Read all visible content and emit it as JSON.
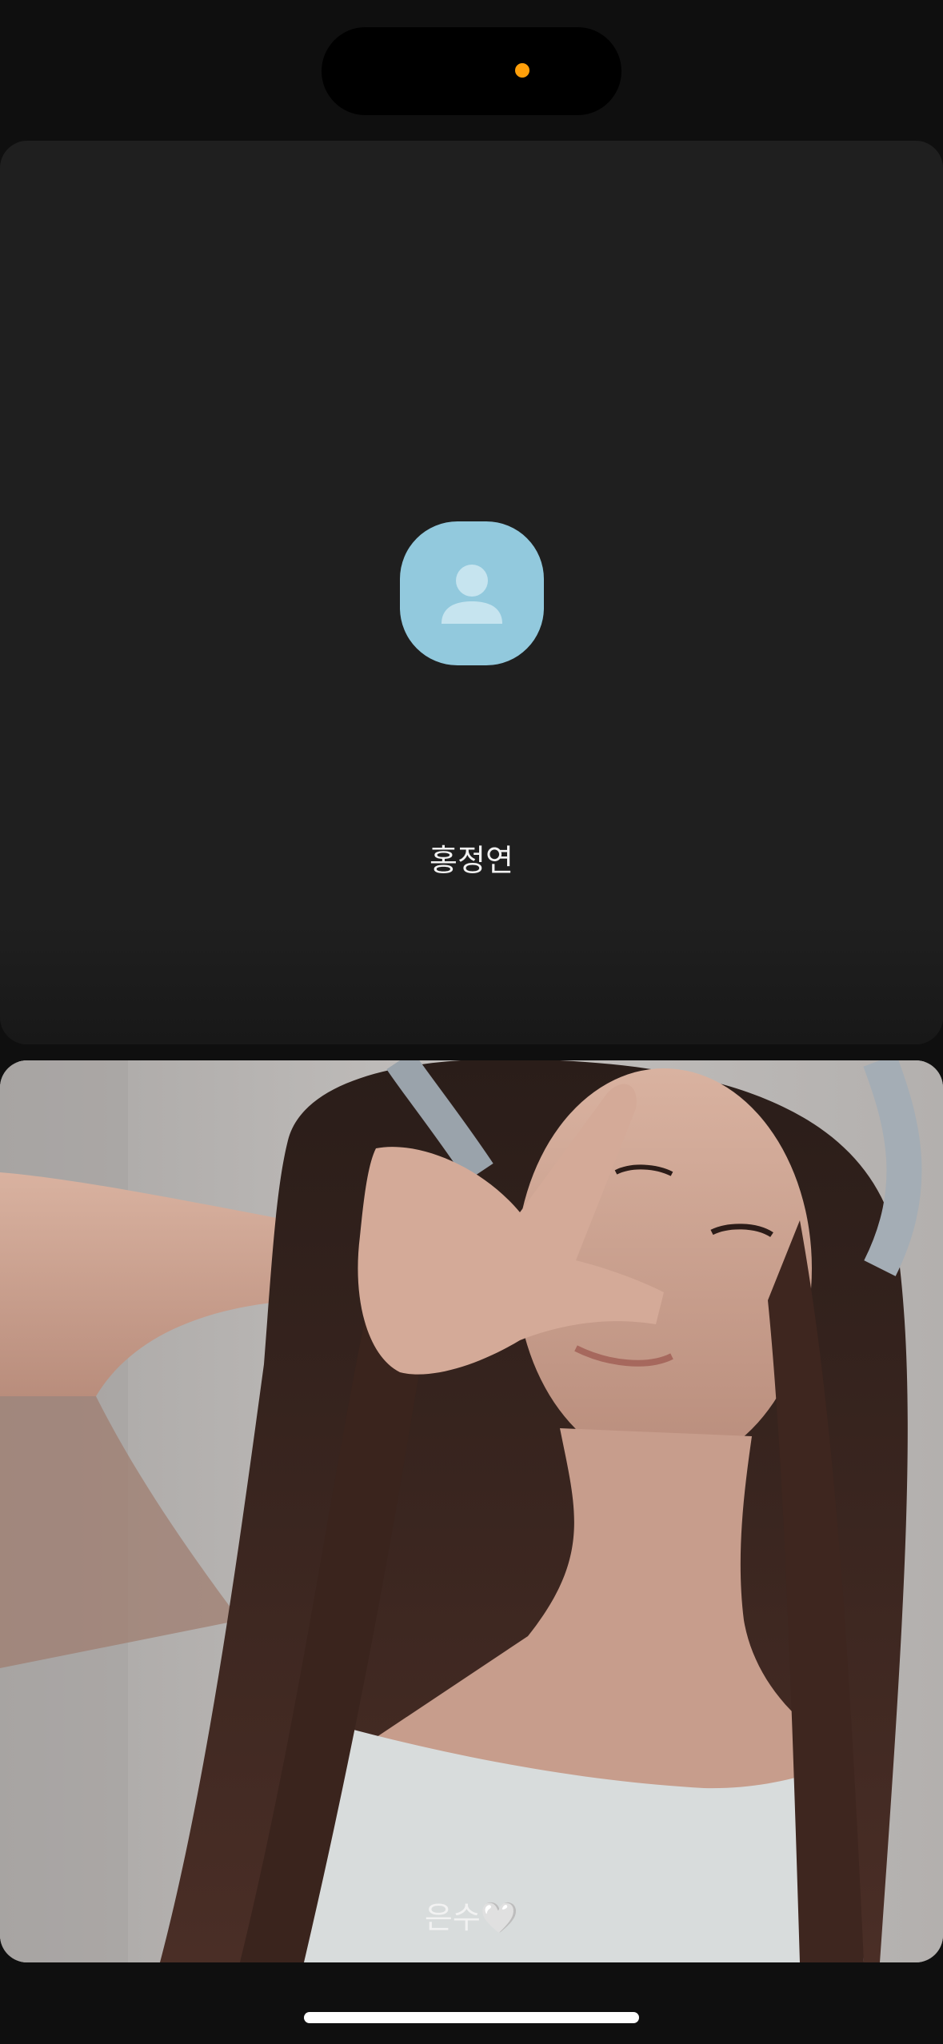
{
  "call": {
    "participants": [
      {
        "name": "홍정연",
        "video": "off",
        "avatar_icon": "person-icon",
        "avatar_color": "#92c9dd"
      },
      {
        "name": "은수🤍",
        "video": "on"
      }
    ]
  },
  "system": {
    "camera_indicator_color": "#ff9f0a"
  }
}
